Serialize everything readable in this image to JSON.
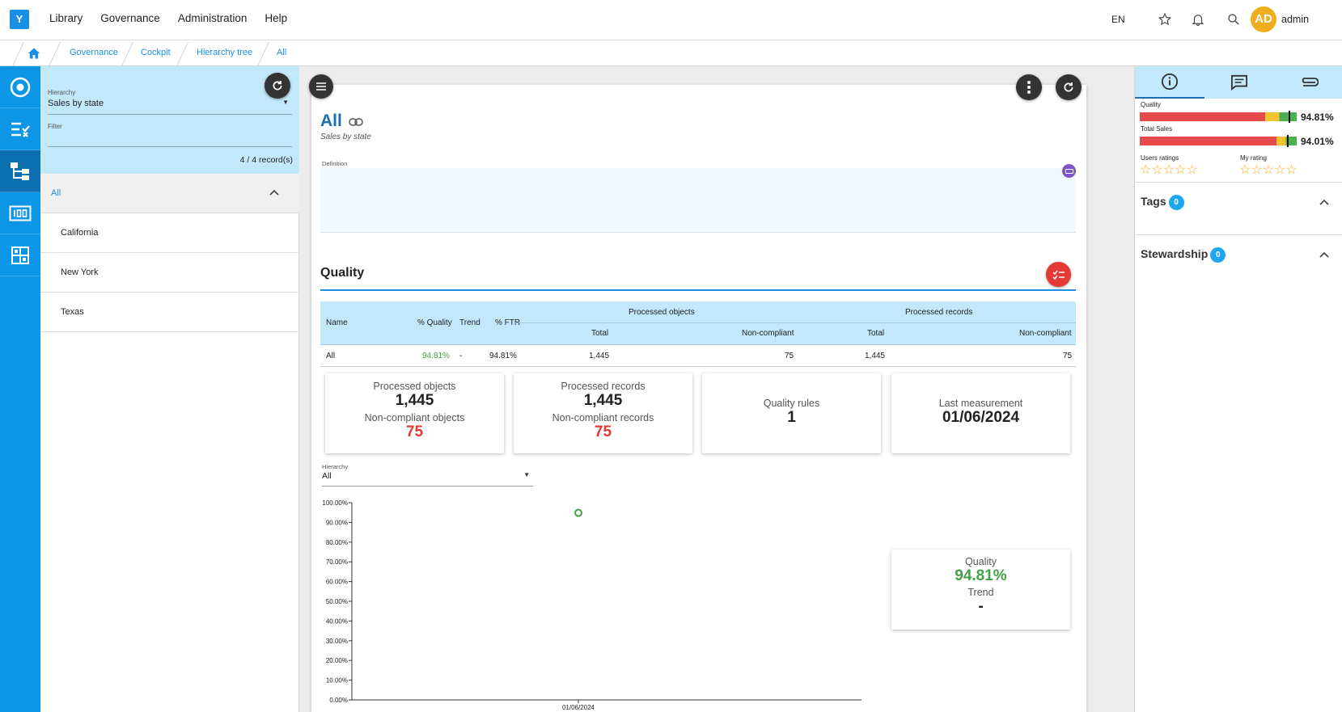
{
  "app": {
    "logo": "Y",
    "menu": [
      "Library",
      "Governance",
      "Administration",
      "Help"
    ],
    "lang": "EN",
    "avatar_initials": "AD",
    "username": "admin"
  },
  "breadcrumb": [
    "Governance",
    "Cockpit",
    "Hierarchy tree",
    "All"
  ],
  "tree": {
    "hierarchy_label": "Hierarchy",
    "hierarchy_value": "Sales by state",
    "filter_label": "Filter",
    "record_count": "4 / 4 record(s)",
    "root": "All",
    "children": [
      "California",
      "New York",
      "Texas"
    ]
  },
  "main": {
    "title": "All",
    "subtitle": "Sales by state",
    "definition_label": "Definition",
    "quality_heading": "Quality",
    "table": {
      "headers": {
        "name": "Name",
        "pct_quality": "% Quality",
        "trend": "Trend",
        "pct_ftr": "% FTR",
        "processed_objects": "Processed objects",
        "processed_records": "Processed records",
        "total": "Total",
        "non_compliant": "Non-compliant"
      },
      "row": {
        "name": "All",
        "pct_quality": "94.81%",
        "trend": "-",
        "pct_ftr": "94.81%",
        "obj_total": "1,445",
        "obj_nc": "75",
        "rec_total": "1,445",
        "rec_nc": "75"
      }
    },
    "stats": {
      "processed_objects_label": "Processed objects",
      "processed_objects_value": "1,445",
      "nc_objects_label": "Non-compliant objects",
      "nc_objects_value": "75",
      "processed_records_label": "Processed records",
      "processed_records_value": "1,445",
      "nc_records_label": "Non-compliant records",
      "nc_records_value": "75",
      "quality_rules_label": "Quality rules",
      "quality_rules_value": "1",
      "last_measurement_label": "Last measurement",
      "last_measurement_value": "01/06/2024"
    },
    "chart_filter_label": "Hierarchy",
    "chart_filter_value": "All",
    "summary": {
      "quality_label": "Quality",
      "quality_value": "94.81%",
      "trend_label": "Trend",
      "trend_value": "-"
    }
  },
  "chart_data": {
    "type": "scatter",
    "x": [
      "01/06/2024"
    ],
    "y": [
      94.81
    ],
    "ylim": [
      0,
      100
    ],
    "yticks": [
      "100.00%",
      "90.00%",
      "80.00%",
      "70.00%",
      "60.00%",
      "50.00%",
      "40.00%",
      "30.00%",
      "20.00%",
      "10.00%",
      "0.00%"
    ],
    "xtick": "01/06/2024",
    "point_color": "#43a047"
  },
  "right": {
    "quality_label": "Quality",
    "quality_value": "94.81%",
    "quality_level": 0.9481,
    "total_sales_label": "Total Sales",
    "total_sales_value": "94.01%",
    "total_sales_level": 0.9401,
    "users_ratings_label": "Users ratings",
    "my_rating_label": "My rating",
    "tags_label": "Tags",
    "tags_count": "0",
    "stewardship_label": "Stewardship",
    "stewardship_count": "0"
  },
  "colors": {
    "accent": "#0d96e6",
    "light_accent": "#c2e8fb",
    "bad": "#e53935",
    "warn": "#f4c430",
    "good": "#4caf50"
  }
}
